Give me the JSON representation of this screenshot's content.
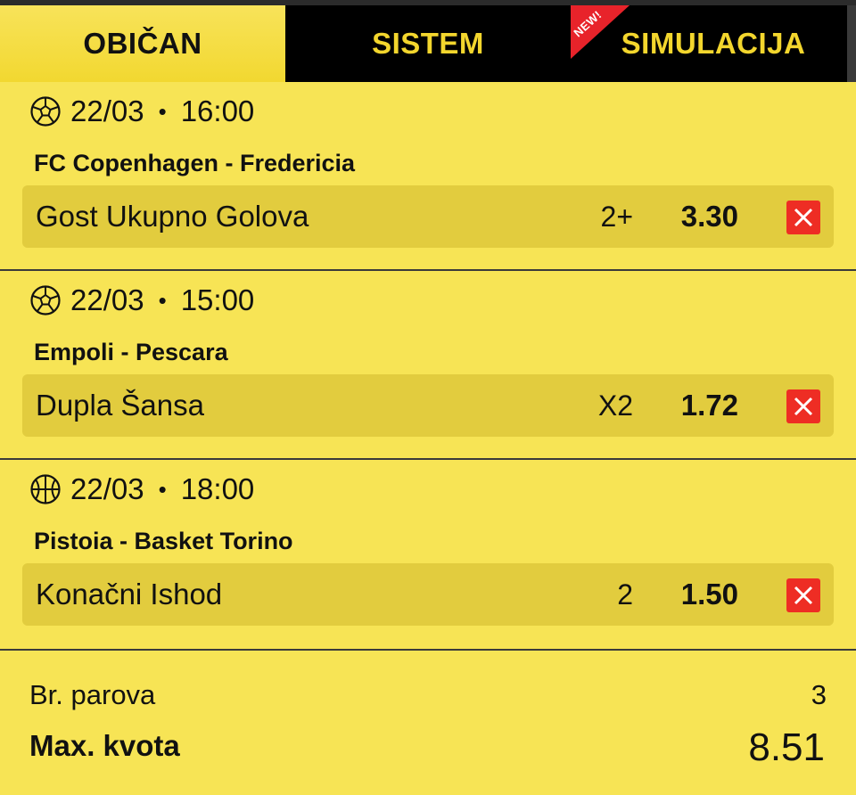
{
  "tabs": [
    {
      "label": "OBIČAN",
      "active": true
    },
    {
      "label": "SISTEM",
      "active": false
    },
    {
      "label": "SIMULACIJA",
      "active": false,
      "badge": "NEW!"
    }
  ],
  "matches": [
    {
      "sport_icon": "football-icon",
      "date": "22/03",
      "separator": "•",
      "time": "16:00",
      "teams": "FC Copenhagen - Fredericia",
      "market": "Gost Ukupno Golova",
      "selection": "2+",
      "odd": "3.30"
    },
    {
      "sport_icon": "football-icon",
      "date": "22/03",
      "separator": "•",
      "time": "15:00",
      "teams": "Empoli - Pescara",
      "market": "Dupla Šansa",
      "selection": "X2",
      "odd": "1.72"
    },
    {
      "sport_icon": "basketball-icon",
      "date": "22/03",
      "separator": "•",
      "time": "18:00",
      "teams": "Pistoia - Basket Torino",
      "market": "Konačni Ishod",
      "selection": "2",
      "odd": "1.50"
    }
  ],
  "summary": {
    "pairs_label": "Br. parova",
    "pairs_value": "3",
    "max_odd_label": "Max. kvota",
    "max_odd_value": "8.51"
  },
  "colors": {
    "background": "#f7e455",
    "pick_row": "#e2cc3e",
    "tab_text": "#f3d62d",
    "remove_button": "#ee2d24",
    "new_badge": "#e8232a"
  }
}
